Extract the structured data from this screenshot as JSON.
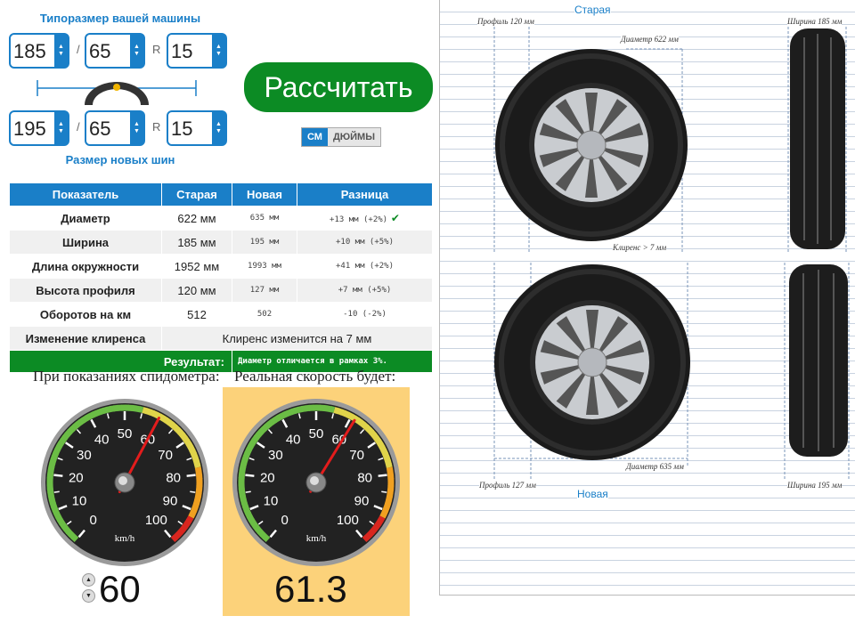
{
  "header": {
    "current_title": "Типоразмер вашей машины",
    "new_title": "Размер новых шин"
  },
  "current_size": {
    "width": "185",
    "profile": "65",
    "r_label": "R",
    "rim": "15",
    "sep": "/"
  },
  "new_size": {
    "width": "195",
    "profile": "65",
    "r_label": "R",
    "rim": "15",
    "sep": "/"
  },
  "actions": {
    "calculate": "Рассчитать"
  },
  "units": {
    "cm": "СМ",
    "inches": "ДЮЙМЫ"
  },
  "table": {
    "headers": [
      "Показатель",
      "Старая",
      "Новая",
      "Разница"
    ],
    "rows": [
      {
        "label": "Диаметр",
        "old": "622 мм",
        "new": "635 мм",
        "diff": "+13 мм (+2%)"
      },
      {
        "label": "Ширина",
        "old": "185 мм",
        "new": "195 мм",
        "diff": "+10 мм (+5%)"
      },
      {
        "label": "Длина окружности",
        "old": "1952 мм",
        "new": "1993 мм",
        "diff": "+41 мм (+2%)"
      },
      {
        "label": "Высота профиля",
        "old": "120 мм",
        "new": "127 мм",
        "diff": "+7 мм (+5%)"
      },
      {
        "label": "Оборотов на км",
        "old": "512",
        "new": "502",
        "diff": "-10 (-2%)"
      }
    ],
    "clearance_label": "Изменение клиренса",
    "clearance_value": "Клиренс изменится на 7 мм",
    "result_label": "Результат:",
    "result_value": "Диаметр отличается в рамках 3%."
  },
  "speedometer": {
    "shown_caption": "При показаниях спидометра:",
    "real_caption": "Реальная скорость будет:",
    "shown_value": "60",
    "real_value": "61.3",
    "unit": "km/h",
    "ticks": [
      "0",
      "10",
      "20",
      "30",
      "40",
      "50",
      "60",
      "70",
      "80",
      "90",
      "100"
    ]
  },
  "diagram": {
    "old_title": "Старая",
    "new_title": "Новая",
    "old_profile": "Профиль 120 мм",
    "old_width": "Ширина 185 мм",
    "old_diameter": "Диаметр 622 мм",
    "clearance": "Клиренс > 7 мм",
    "new_diameter": "Диаметр 635 мм",
    "new_profile": "Профиль 127 мм",
    "new_width": "Ширина 195 мм"
  },
  "colors": {
    "accent": "#1a7fc8",
    "ok": "#0c8b24",
    "highlight": "#fcd27a"
  }
}
